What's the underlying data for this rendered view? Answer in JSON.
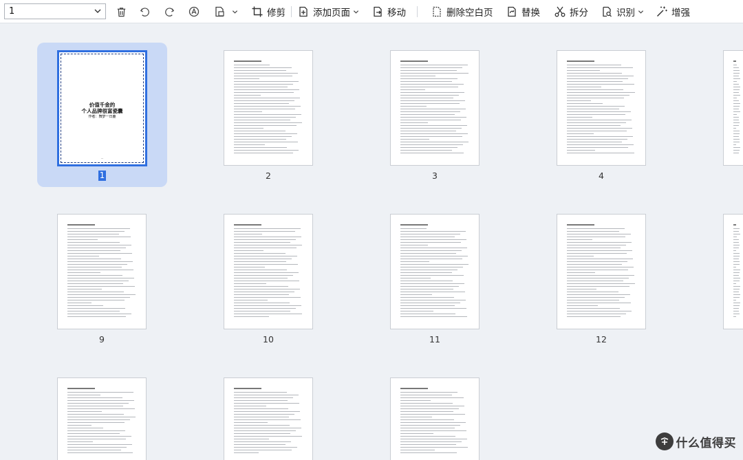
{
  "toolbar": {
    "page_select_value": "1",
    "buttons": [
      {
        "label": "修剪"
      },
      {
        "label": "添加页面"
      },
      {
        "label": "移动"
      },
      {
        "label": "删除空白页"
      },
      {
        "label": "替换"
      },
      {
        "label": "拆分"
      },
      {
        "label": "识别"
      },
      {
        "label": "增强"
      }
    ],
    "icons": [
      "delete-icon",
      "undo-icon",
      "redo-icon",
      "rotate-icon",
      "save-page-icon",
      "crop-icon",
      "add-page-icon",
      "move-icon",
      "delete-blank-icon",
      "replace-icon",
      "split-icon",
      "recognize-icon",
      "enhance-icon"
    ]
  },
  "pages": [
    {
      "number": "1",
      "selected": true
    },
    {
      "number": "2"
    },
    {
      "number": "3"
    },
    {
      "number": "4"
    },
    {
      "number": "9"
    },
    {
      "number": "10"
    },
    {
      "number": "11"
    },
    {
      "number": "12"
    }
  ],
  "cover": {
    "title_line1": "价值千金的",
    "title_line2": "个人品牌很富瓷囊",
    "author": "作者：舞梦一日鹿"
  },
  "watermark": {
    "text": "什么值得买"
  },
  "colors": {
    "accent": "#2f6fe0",
    "selection_bg": "#c9d9f6",
    "background": "#eef1f5"
  }
}
